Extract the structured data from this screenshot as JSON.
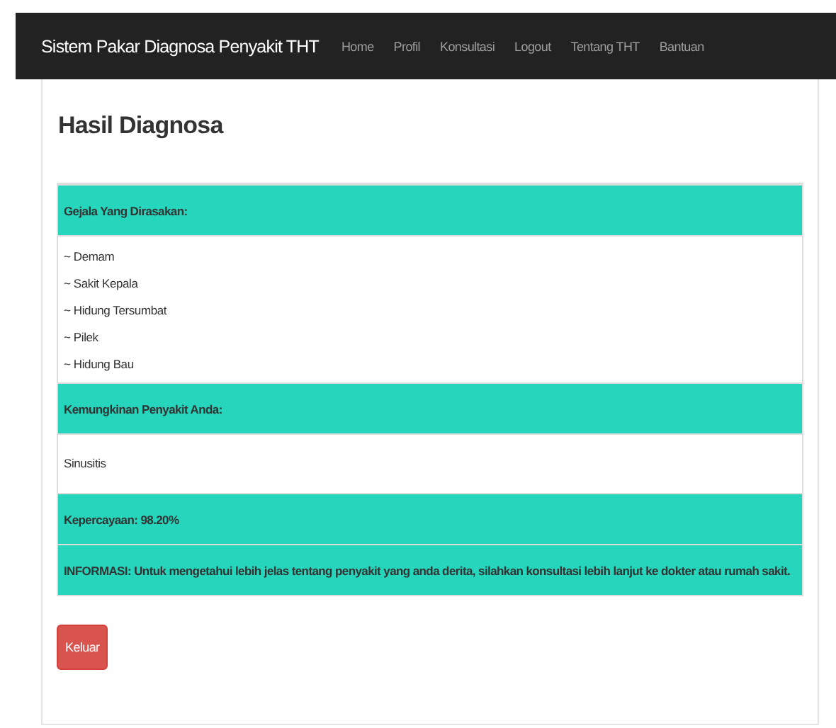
{
  "navbar": {
    "brand": "Sistem Pakar Diagnosa Penyakit THT",
    "items": [
      "Home",
      "Profil",
      "Konsultasi",
      "Logout",
      "Tentang THT",
      "Bantuan"
    ]
  },
  "title": "Hasil Diagnosa",
  "table": {
    "rows": [
      {
        "kind": "header",
        "text": "Gejala Yang Dirasakan:"
      },
      {
        "kind": "list",
        "items": [
          "~ Demam",
          "~ Sakit Kepala",
          "~ Hidung Tersumbat",
          "~ Pilek",
          "~ Hidung Bau"
        ]
      },
      {
        "kind": "header",
        "text": "Kemungkinan Penyakit Anda:"
      },
      {
        "kind": "text",
        "text": "Sinusitis"
      },
      {
        "kind": "header",
        "text": "Kepercayaan: 98.20%"
      },
      {
        "kind": "header",
        "text": "INFORMASI: Untuk mengetahui lebih jelas tentang penyakit yang anda derita, silahkan konsultasi lebih lanjut ke dokter atau rumah sakit."
      }
    ]
  },
  "buttons": [
    "Keluar"
  ]
}
